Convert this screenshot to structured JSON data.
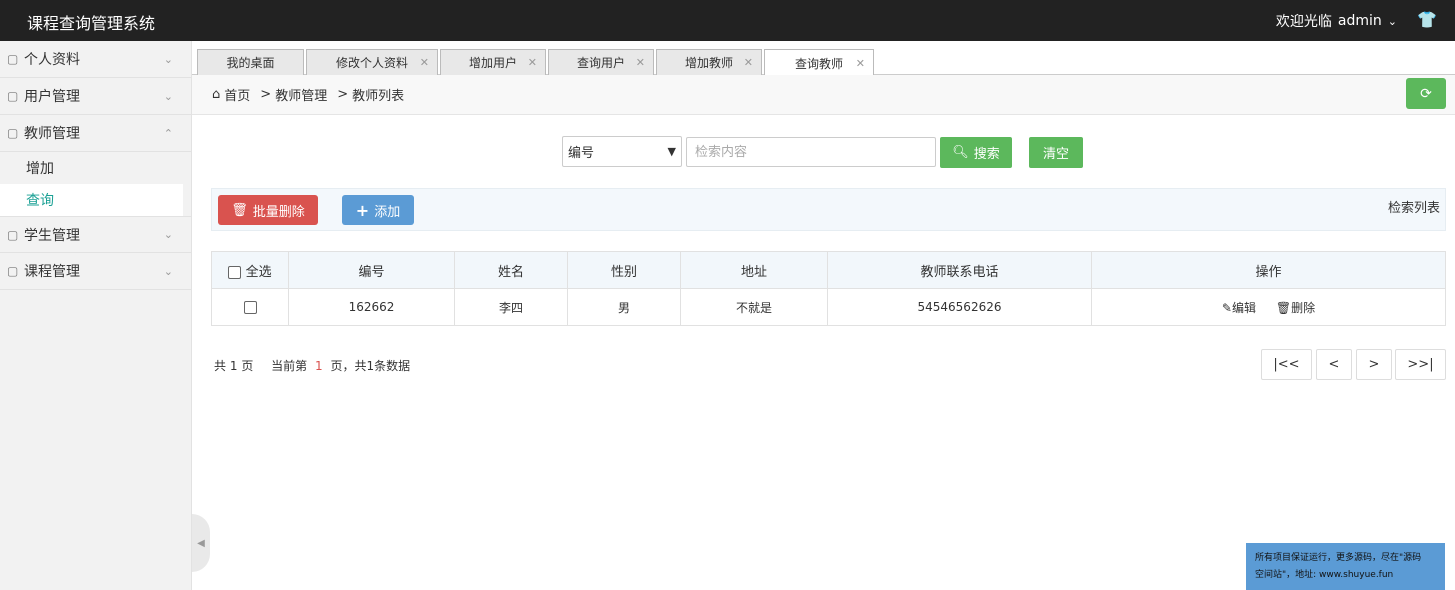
{
  "header": {
    "title": "课程查询管理系统",
    "welcome": "欢迎光临",
    "username": "admin"
  },
  "sidebar": {
    "items": [
      {
        "label": "个人资料"
      },
      {
        "label": "用户管理"
      },
      {
        "label": "教师管理"
      },
      {
        "label": "学生管理"
      },
      {
        "label": "课程管理"
      }
    ],
    "sub_items": [
      {
        "label": "增加"
      },
      {
        "label": "查询"
      }
    ]
  },
  "tabs": [
    {
      "label": "我的桌面"
    },
    {
      "label": "修改个人资料"
    },
    {
      "label": "增加用户"
    },
    {
      "label": "查询用户"
    },
    {
      "label": "增加教师"
    },
    {
      "label": "查询教师"
    }
  ],
  "breadcrumb": {
    "home": "首页",
    "level1": "教师管理",
    "level2": "教师列表",
    "sep": ">"
  },
  "search": {
    "field_selected": "编号",
    "placeholder": "检索内容",
    "search_label": "搜索",
    "clear_label": "清空"
  },
  "actions": {
    "batch_delete": "批量删除",
    "add": "添加",
    "list_title": "检索列表"
  },
  "table": {
    "headers": [
      "全选",
      "编号",
      "姓名",
      "性别",
      "地址",
      "教师联系电话",
      "操作"
    ],
    "rows": [
      {
        "id": "162662",
        "name": "李四",
        "gender": "男",
        "address": "不就是",
        "phone": "54546562626"
      }
    ],
    "edit_label": "编辑",
    "delete_label": "删除"
  },
  "pagination": {
    "total_pages_prefix": "共",
    "total_pages": "1",
    "total_pages_suffix": "页",
    "current_prefix": "当前第",
    "current_page": "1",
    "current_suffix": "页，共1条数据",
    "first": "|<<",
    "prev": "<",
    "next": ">",
    "last": ">>|"
  },
  "notice": {
    "line1": "所有项目保证运行，更多源码，尽在\"源码",
    "line2": "空间站\"，地址: www.shuyue.fun"
  },
  "colors": {
    "header_bg": "#222222",
    "green": "#5cb85c",
    "danger": "#d9534f",
    "primary": "#5b9bd5",
    "active_sub": "#1aa094"
  }
}
